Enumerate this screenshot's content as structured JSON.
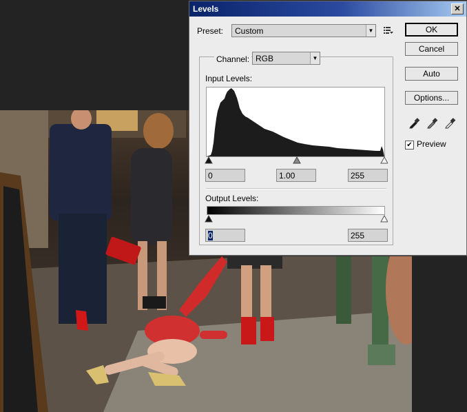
{
  "dialog": {
    "title": "Levels",
    "close_glyph": "✕",
    "preset": {
      "label": "Preset:",
      "value": "Custom",
      "menu_icon": "preset-options-icon"
    },
    "channel": {
      "label": "Channel:",
      "value": "RGB"
    },
    "input_levels": {
      "label": "Input Levels:",
      "black": "0",
      "gamma": "1.00",
      "white": "255"
    },
    "output_levels": {
      "label": "Output Levels:",
      "black": "0",
      "white": "255"
    },
    "buttons": {
      "ok": "OK",
      "cancel": "Cancel",
      "auto": "Auto",
      "options": "Options..."
    },
    "preview": {
      "label": "Preview",
      "checked": true
    },
    "eyedroppers": [
      "black-point-eyedropper-icon",
      "gray-point-eyedropper-icon",
      "white-point-eyedropper-icon"
    ],
    "colors": {
      "titlebar_start": "#0a246a",
      "titlebar_end": "#a6caf0",
      "dialog_bg": "#ececec",
      "histogram_fill": "#1c1c1c"
    }
  }
}
